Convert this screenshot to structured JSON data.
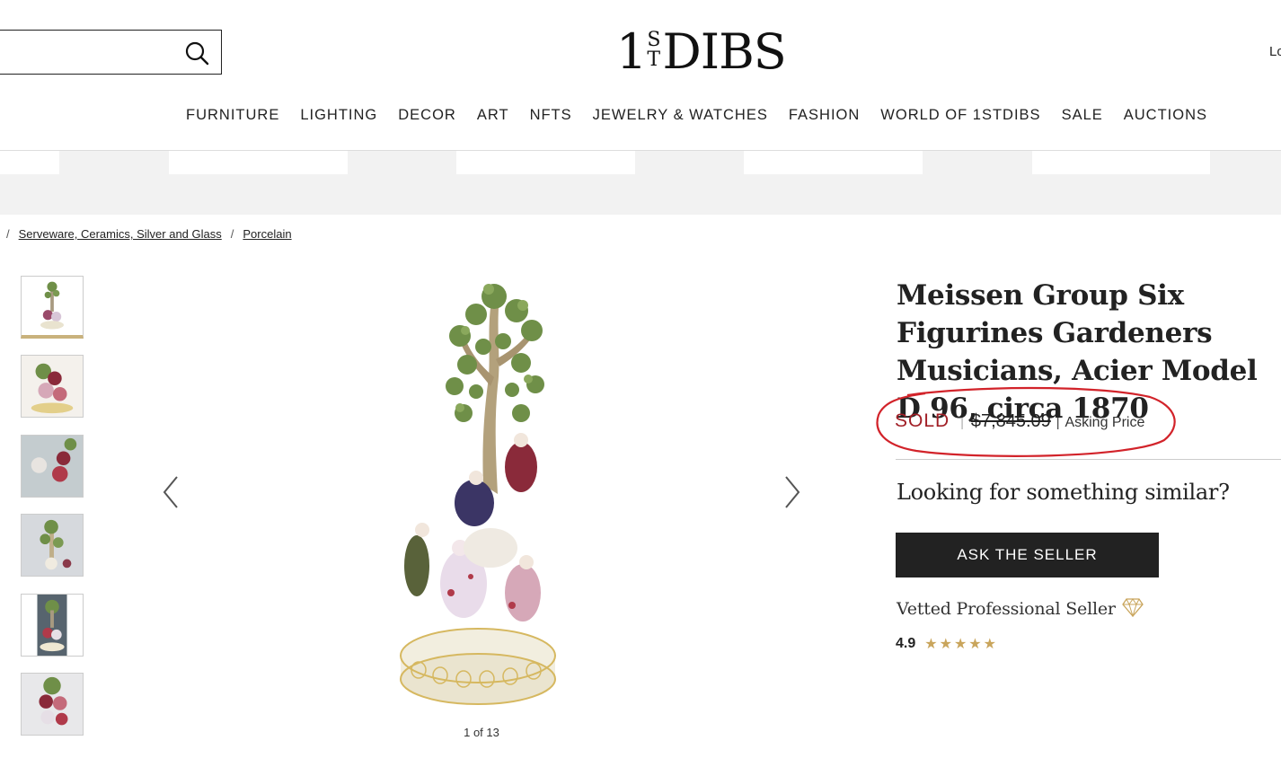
{
  "header": {
    "logo": {
      "one": "1",
      "s": "S",
      "t": "T",
      "dibs": "DIBS"
    },
    "login_label": "Log In",
    "search": {
      "value": "",
      "placeholder": ""
    }
  },
  "nav": {
    "items": [
      {
        "label": "FURNITURE"
      },
      {
        "label": "LIGHTING"
      },
      {
        "label": "DECOR"
      },
      {
        "label": "ART"
      },
      {
        "label": "NFTS"
      },
      {
        "label": "JEWELRY & WATCHES"
      },
      {
        "label": "FASHION"
      },
      {
        "label": "WORLD OF 1STDIBS"
      },
      {
        "label": "SALE"
      },
      {
        "label": "AUCTIONS"
      }
    ]
  },
  "breadcrumb": {
    "items": [
      {
        "label": "Serveware, Ceramics, Silver and Glass"
      },
      {
        "label": "Porcelain"
      }
    ]
  },
  "gallery": {
    "counter": "1 of 13",
    "thumbnail_count": 6
  },
  "product": {
    "title": "Meissen Group Six Figurines Gardeners Musicians, Acier Model D 96, circa 1870",
    "status": "SOLD",
    "price": "$7,845.09",
    "price_note": "Asking Price"
  },
  "similar": {
    "heading": "Looking for something similar?",
    "button_label": "ASK THE SELLER"
  },
  "seller": {
    "label": "Vetted Professional Seller",
    "rating": "4.9",
    "star_count": 5
  },
  "colors": {
    "sold": "#a11f26",
    "star": "#c9a55c",
    "annotation": "#d2232a",
    "button": "#222222"
  }
}
